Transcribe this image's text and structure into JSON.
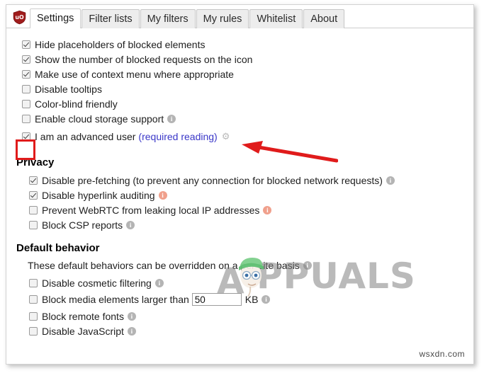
{
  "window": {
    "logo_icon": "ublock-origin-shield-icon",
    "logo_text": "uO"
  },
  "tabs": [
    {
      "label": "Settings",
      "active": true
    },
    {
      "label": "Filter lists",
      "active": false
    },
    {
      "label": "My filters",
      "active": false
    },
    {
      "label": "My rules",
      "active": false
    },
    {
      "label": "Whitelist",
      "active": false
    },
    {
      "label": "About",
      "active": false
    }
  ],
  "general_options": [
    {
      "label": "Hide placeholders of blocked elements",
      "checked": true,
      "info": "none"
    },
    {
      "label": "Show the number of blocked requests on the icon",
      "checked": true,
      "info": "none"
    },
    {
      "label": "Make use of context menu where appropriate",
      "checked": true,
      "info": "none"
    },
    {
      "label": "Disable tooltips",
      "checked": false,
      "info": "none"
    },
    {
      "label": "Color-blind friendly",
      "checked": false,
      "info": "none"
    },
    {
      "label": "Enable cloud storage support",
      "checked": false,
      "info": "gray"
    }
  ],
  "advanced_user": {
    "label_before": "I am an advanced user",
    "link_text": "(required reading)",
    "checked": true,
    "gears_icon": "gears-icon",
    "gears_glyph": "⚙"
  },
  "privacy": {
    "heading": "Privacy",
    "options": [
      {
        "label": "Disable pre-fetching (to prevent any connection for blocked network requests)",
        "checked": true,
        "info": "gray"
      },
      {
        "label": "Disable hyperlink auditing",
        "checked": true,
        "info": "warn"
      },
      {
        "label": "Prevent WebRTC from leaking local IP addresses",
        "checked": false,
        "info": "warn"
      },
      {
        "label": "Block CSP reports",
        "checked": false,
        "info": "gray"
      }
    ]
  },
  "default_behavior": {
    "heading": "Default behavior",
    "note": "These default behaviors can be overridden on a per-site basis",
    "note_info": "gray",
    "options": [
      {
        "label": "Disable cosmetic filtering",
        "checked": false,
        "info": "gray"
      },
      {
        "label": "Block remote fonts",
        "checked": false,
        "info": "gray"
      },
      {
        "label": "Disable JavaScript",
        "checked": false,
        "info": "gray"
      }
    ],
    "media_row": {
      "label": "Block media elements larger than",
      "checked": false,
      "value": "50",
      "placeholder": "",
      "unit": "KB",
      "info": "gray"
    }
  },
  "annotations": {
    "highlight_box_color": "#e01b1b",
    "arrow_color": "#e01b1b",
    "arrow_icon": "left-pointing-arrow-icon"
  },
  "watermarks": {
    "brand_text": "PPUALS",
    "brand_initial": "A",
    "source_text": "wsxdn.com"
  }
}
